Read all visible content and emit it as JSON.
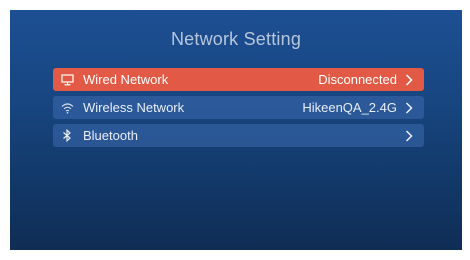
{
  "title": "Network Setting",
  "menu": {
    "items": [
      {
        "label": "Wired Network",
        "value": "Disconnected",
        "icon": "monitor-icon",
        "selected": true
      },
      {
        "label": "Wireless Network",
        "value": "HikeenQA_2.4G",
        "icon": "wifi-icon",
        "selected": false
      },
      {
        "label": "Bluetooth",
        "value": "",
        "icon": "bluetooth-icon",
        "selected": false
      }
    ]
  },
  "colors": {
    "selected_bg": "#e25a45",
    "item_bg": "#2f5f9f",
    "screen_bg": "#17457f"
  }
}
